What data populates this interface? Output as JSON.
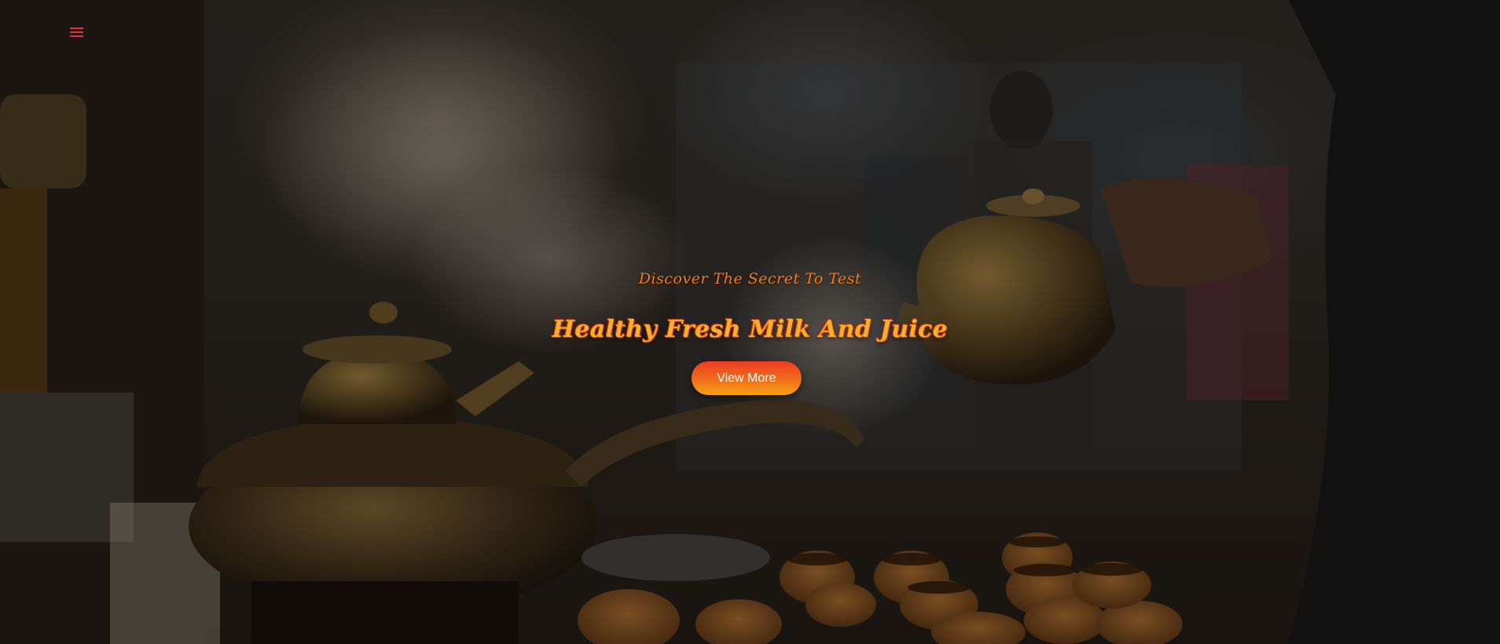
{
  "nav": {
    "menu_icon": "hamburger-menu-icon",
    "menu_color": "#e0343a"
  },
  "hero": {
    "subtitle": "Discover The Secret To Test",
    "title": "Healthy Fresh Milk And Juice",
    "button_label": "View More",
    "subtitle_color": "#f07a22",
    "title_color": "#f6b12a",
    "button_gradient": [
      "#ec3b22",
      "#f7a114"
    ]
  }
}
